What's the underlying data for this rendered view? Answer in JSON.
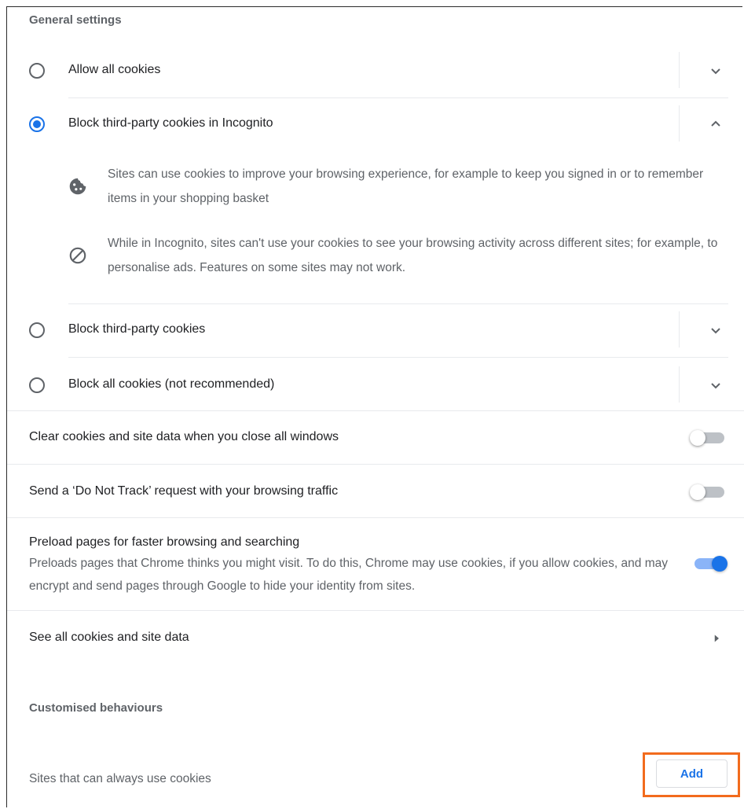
{
  "general_settings": {
    "title": "General settings",
    "options": [
      {
        "label": "Allow all cookies",
        "checked": false,
        "expanded": false
      },
      {
        "label": "Block third-party cookies in Incognito",
        "checked": true,
        "expanded": true
      },
      {
        "label": "Block third-party cookies",
        "checked": false,
        "expanded": false
      },
      {
        "label": "Block all cookies (not recommended)",
        "checked": false,
        "expanded": false
      }
    ],
    "expanded_details": [
      {
        "icon": "cookie-icon",
        "text": "Sites can use cookies to improve your browsing experience, for example to keep you signed in or to remember items in your shopping basket"
      },
      {
        "icon": "block-icon",
        "text": "While in Incognito, sites can't use your cookies to see your browsing activity across different sites; for example, to personalise ads. Features on some sites may not work."
      }
    ]
  },
  "toggles": {
    "clear_on_close": {
      "label": "Clear cookies and site data when you close all windows",
      "on": false
    },
    "do_not_track": {
      "label": "Send a ‘Do Not Track’ request with your browsing traffic",
      "on": false
    },
    "preload": {
      "label": "Preload pages for faster browsing and searching",
      "sublabel": "Preloads pages that Chrome thinks you might visit. To do this, Chrome may use cookies, if you allow cookies, and may encrypt and send pages through Google to hide your identity from sites.",
      "on": true
    }
  },
  "see_all": {
    "label": "See all cookies and site data"
  },
  "customised": {
    "title": "Customised behaviours",
    "always_allow_label": "Sites that can always use cookies",
    "add_label": "Add"
  },
  "colors": {
    "accent": "#1a73e8",
    "highlight": "#f26b1d"
  }
}
